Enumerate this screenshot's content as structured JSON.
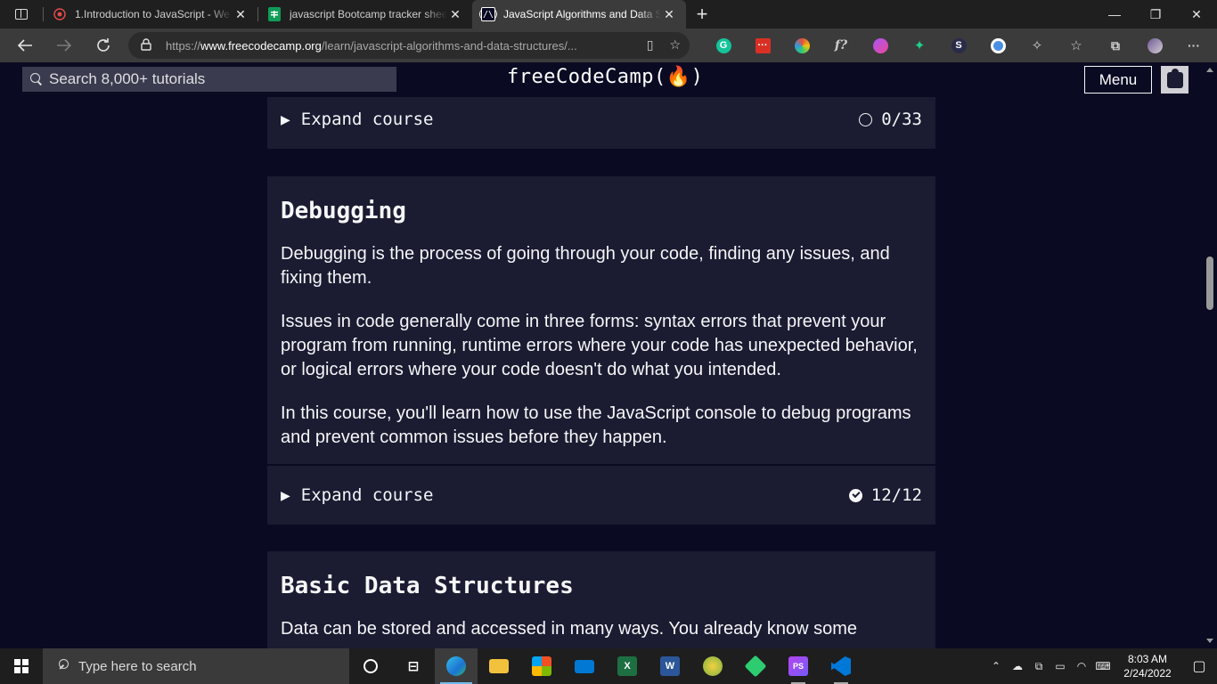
{
  "browser": {
    "tabs": [
      {
        "title": "1.Introduction to JavaScript - We",
        "favicon": "record-icon",
        "active": false
      },
      {
        "title": "javascript Bootcamp tracker shee",
        "favicon": "sheets-icon",
        "active": false
      },
      {
        "title": "JavaScript Algorithms and Data S",
        "favicon": "fcc-icon",
        "active": true
      }
    ],
    "new_tab": "+",
    "window": {
      "minimize": "—",
      "restore": "❐",
      "close": "✕"
    },
    "url_prefix": "https://",
    "url_host": "www.freecodecamp.org",
    "url_path": "/learn/javascript-algorithms-and-data-structures/..."
  },
  "fcc": {
    "search_placeholder": "Search 8,000+ tutorials",
    "logo": "freeCodeCamp(🔥)",
    "menu": "Menu"
  },
  "top_expand": {
    "label": "Expand course",
    "progress": "0/33",
    "state": "incomplete"
  },
  "debugging": {
    "title": "Debugging",
    "paragraphs": [
      "Debugging is the process of going through your code, finding any issues, and fixing them.",
      "Issues in code generally come in three forms: syntax errors that prevent your program from running, runtime errors where your code has unexpected behavior, or logical errors where your code doesn't do what you intended.",
      "In this course, you'll learn how to use the JavaScript console to debug programs and prevent common issues before they happen."
    ],
    "expand": {
      "label": "Expand course",
      "progress": "12/12",
      "state": "complete"
    }
  },
  "basic_ds": {
    "title": "Basic Data Structures",
    "paragraph": "Data can be stored and accessed in many ways. You already know some"
  },
  "taskbar": {
    "search_placeholder": "Type here to search",
    "time": "8:03 AM",
    "date": "2/24/2022"
  },
  "colors": {
    "page_bg": "#0a0a23",
    "panel_bg": "#1b1b32",
    "text": "#f5f6f7",
    "search_bg": "#3b3b4f"
  }
}
